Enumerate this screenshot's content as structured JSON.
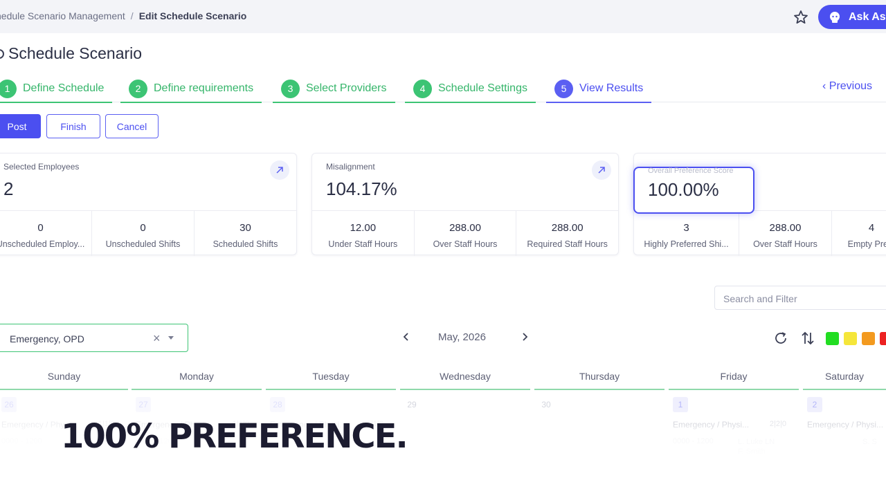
{
  "breadcrumb": {
    "parent": "hedule Scenario Management",
    "separator": "/",
    "current": "Edit Schedule Scenario"
  },
  "header": {
    "ask_label": "Ask Ass",
    "star_icon": "star-icon",
    "ask_icon": "assistant-icon"
  },
  "page": {
    "title": "Schedule Scenario"
  },
  "steps": [
    {
      "num": "1",
      "label": "Define Schedule",
      "state": "complete"
    },
    {
      "num": "2",
      "label": "Define requirements",
      "state": "complete"
    },
    {
      "num": "3",
      "label": "Select Providers",
      "state": "complete"
    },
    {
      "num": "4",
      "label": "Schedule Settings",
      "state": "complete"
    },
    {
      "num": "5",
      "label": "View Results",
      "state": "active"
    }
  ],
  "nav": {
    "previous_label": "Previous"
  },
  "actions": {
    "post": "Post",
    "finish": "Finish",
    "cancel": "Cancel"
  },
  "cards": {
    "employees": {
      "label": "Selected Employees",
      "value": "2",
      "subs": [
        {
          "v": "0",
          "t": "Unscheduled Employ..."
        },
        {
          "v": "0",
          "t": "Unscheduled Shifts"
        },
        {
          "v": "30",
          "t": "Scheduled Shifts"
        }
      ]
    },
    "misalignment": {
      "label": "Misalignment",
      "value": "104.17%",
      "subs": [
        {
          "v": "12.00",
          "t": "Under Staff Hours"
        },
        {
          "v": "288.00",
          "t": "Over Staff Hours"
        },
        {
          "v": "288.00",
          "t": "Required Staff Hours"
        }
      ]
    },
    "preference": {
      "label": "Overall Preference Score",
      "value": "100.00%",
      "subs": [
        {
          "v": "3",
          "t": "Highly Preferred Shi..."
        },
        {
          "v": "288.00",
          "t": "Over Staff Hours"
        },
        {
          "v": "4",
          "t": "Empty Prefe"
        }
      ]
    }
  },
  "filter": {
    "placeholder": "Search and Filter"
  },
  "department": {
    "value": "Emergency, OPD"
  },
  "calendar": {
    "month": "May, 2026",
    "days": [
      "Sunday",
      "Monday",
      "Tuesday",
      "Wednesday",
      "Thursday",
      "Friday",
      "Saturday"
    ],
    "cells": [
      {
        "date": "26",
        "shift": "Emergency / Physi...",
        "count": "1|1|0",
        "time": "0000 - 1200",
        "names": ""
      },
      {
        "date": "27",
        "shift": "Emergency / Physi...",
        "count": "1|1|0",
        "time": "0000 - 1200",
        "names": ""
      },
      {
        "date": "28",
        "shift": "Emergency / Physi...",
        "count": "1|1|0",
        "time": "",
        "names": ""
      },
      {
        "date": "29",
        "shift": "",
        "count": "",
        "time": "",
        "names": ""
      },
      {
        "date": "30",
        "shift": "",
        "count": "",
        "time": "",
        "names": ""
      },
      {
        "date": "1",
        "shift": "Emergency / Physi...",
        "count": "2|2|0",
        "time": "0000 - 1200",
        "names": "L. Luke LN\nF. Smith"
      },
      {
        "date": "2",
        "shift": "Emergency / Physi...",
        "count": "",
        "time": "",
        "names": "S. S"
      }
    ]
  },
  "legend_colors": [
    "#22dd22",
    "#f5e63a",
    "#f39a1f",
    "#ec2222"
  ],
  "caption": "100% PREFERENCE."
}
